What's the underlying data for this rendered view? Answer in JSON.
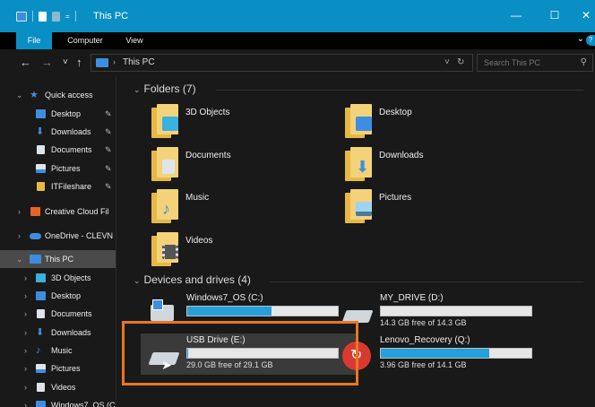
{
  "window": {
    "title": "This PC",
    "controls": {
      "minimize": "—",
      "maximize": "☐",
      "close": "✕"
    }
  },
  "ribbon": {
    "tabs": [
      {
        "label": "File",
        "active": true
      },
      {
        "label": "Computer",
        "active": false
      },
      {
        "label": "View",
        "active": false
      }
    ],
    "collapse_icon": "chevron-down-icon",
    "help_label": "?"
  },
  "addressbar": {
    "path": "This PC",
    "search_placeholder": "Search This PC",
    "nav_glyphs": {
      "back": "←",
      "forward": "→",
      "recent": "˅",
      "up": "↑",
      "dropdown": "˅",
      "refresh": "↻",
      "search": "⚲",
      "chevron": "›"
    }
  },
  "sidebar": {
    "items": [
      {
        "label": "Quick access",
        "icon": "star-icon",
        "color": "#3d8ee0",
        "level": 0,
        "expanded": true
      },
      {
        "label": "Desktop",
        "icon": "desktop-icon",
        "color": "#3d8ee0",
        "level": 1,
        "pinned": true
      },
      {
        "label": "Downloads",
        "icon": "download-icon",
        "color": "#3d8ee0",
        "level": 1,
        "pinned": true
      },
      {
        "label": "Documents",
        "icon": "document-icon",
        "color": "#dfe4ea",
        "level": 1,
        "pinned": true
      },
      {
        "label": "Pictures",
        "icon": "pictures-icon",
        "color": "#dfe4ea",
        "level": 1,
        "pinned": true
      },
      {
        "label": "ITFileshare",
        "icon": "folder-icon",
        "color": "#e8b845",
        "level": 1,
        "pinned": true
      },
      {
        "label": "Creative Cloud Fil",
        "icon": "creative-cloud-icon",
        "color": "#e8632a",
        "level": 0,
        "expanded": false
      },
      {
        "label": "OneDrive - CLEVN",
        "icon": "cloud-icon",
        "color": "#3d8ee0",
        "level": 0,
        "expanded": false
      },
      {
        "label": "This PC",
        "icon": "computer-icon",
        "color": "#3d8ee0",
        "level": 0,
        "expanded": true,
        "selected": true
      },
      {
        "label": "3D Objects",
        "icon": "cube-icon",
        "color": "#3ab1e0",
        "level": 1
      },
      {
        "label": "Desktop",
        "icon": "desktop-icon",
        "color": "#3d8ee0",
        "level": 1
      },
      {
        "label": "Documents",
        "icon": "document-icon",
        "color": "#dfe4ea",
        "level": 1
      },
      {
        "label": "Downloads",
        "icon": "download-icon",
        "color": "#3d8ee0",
        "level": 1
      },
      {
        "label": "Music",
        "icon": "music-icon",
        "color": "#3d8ee0",
        "level": 1
      },
      {
        "label": "Pictures",
        "icon": "pictures-icon",
        "color": "#dfe4ea",
        "level": 1
      },
      {
        "label": "Videos",
        "icon": "video-icon",
        "color": "#dfe4ea",
        "level": 1
      },
      {
        "label": "Windows7_OS (C",
        "icon": "drive-icon",
        "color": "#3d8ee0",
        "level": 1
      }
    ]
  },
  "main": {
    "folders_header": "Folders (7)",
    "folders": [
      {
        "label": "3D Objects",
        "badge": "cube-icon",
        "badge_color": "#3ab1e0"
      },
      {
        "label": "Desktop",
        "badge": "desktop-icon",
        "badge_color": "#3d8ee0"
      },
      {
        "label": "Documents",
        "badge": "document-icon",
        "badge_color": "#dfe4ea"
      },
      {
        "label": "Downloads",
        "badge": "download-icon",
        "badge_color": "#3d8ee0"
      },
      {
        "label": "Music",
        "badge": "music-icon",
        "badge_color": "#3d8ee0"
      },
      {
        "label": "Pictures",
        "badge": "pictures-icon",
        "badge_color": "#9fd3f0"
      },
      {
        "label": "Videos",
        "badge": "video-icon",
        "badge_color": "#555555"
      }
    ],
    "devices_header": "Devices and drives (4)",
    "drives": [
      {
        "name": "Windows7_OS (C:)",
        "free": "",
        "used_fraction": 0.56,
        "icon": "windows-drive-icon"
      },
      {
        "name": "MY_DRIVE (D:)",
        "free": "14.3 GB free of 14.3 GB",
        "used_fraction": 0.0,
        "icon": "removable-drive-icon"
      },
      {
        "name": "USB Drive (E:)",
        "free": "29.0 GB free of 29.1 GB",
        "used_fraction": 0.004,
        "icon": "usb-drive-icon",
        "selected": true
      },
      {
        "name": "Lenovo_Recovery (Q:)",
        "free": "3.96 GB free of 14.1 GB",
        "used_fraction": 0.72,
        "icon": "recovery-drive-icon"
      }
    ]
  },
  "colors": {
    "accent": "#0a8fc4",
    "highlight": "#e87722",
    "bar_fill": "#26a0da"
  }
}
